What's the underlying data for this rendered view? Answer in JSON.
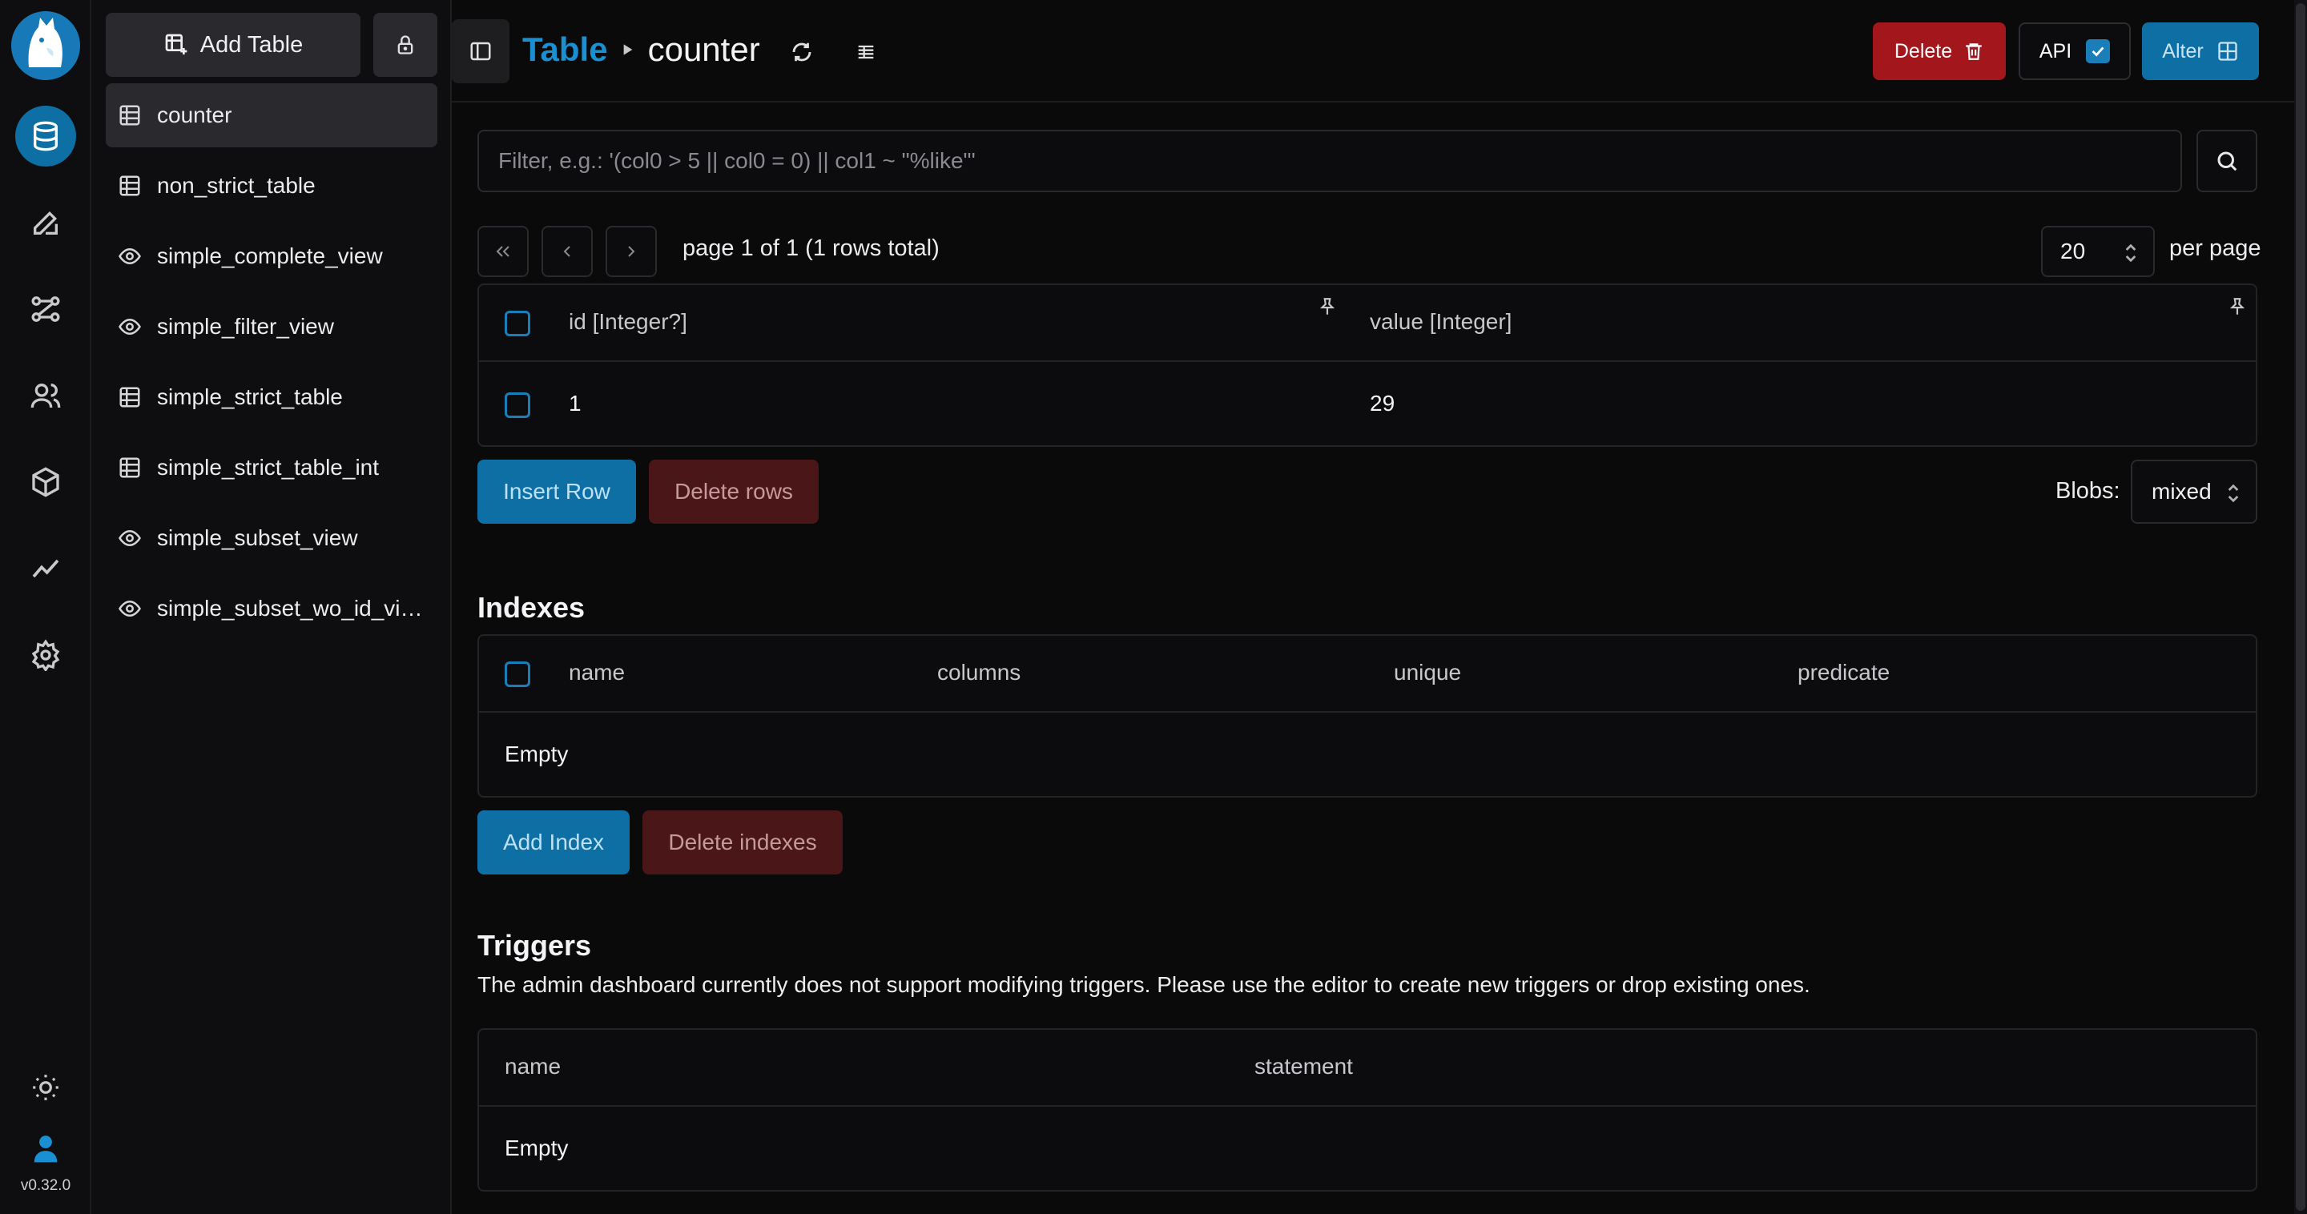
{
  "version": "v0.32.0",
  "sidebar": {
    "add_table_label": "Add Table",
    "items": [
      {
        "label": "counter",
        "kind": "table"
      },
      {
        "label": "non_strict_table",
        "kind": "table"
      },
      {
        "label": "simple_complete_view",
        "kind": "view"
      },
      {
        "label": "simple_filter_view",
        "kind": "view"
      },
      {
        "label": "simple_strict_table",
        "kind": "table"
      },
      {
        "label": "simple_strict_table_int",
        "kind": "table"
      },
      {
        "label": "simple_subset_view",
        "kind": "view"
      },
      {
        "label": "simple_subset_wo_id_vi…",
        "kind": "view"
      }
    ]
  },
  "header": {
    "section": "Table",
    "table_name": "counter",
    "delete_label": "Delete",
    "api_label": "API",
    "alter_label": "Alter"
  },
  "filter": {
    "placeholder": "Filter, e.g.: '(col0 > 5 || col0 = 0) || col1 ~ \"%like\"'"
  },
  "pagination": {
    "status": "page 1 of 1 (1 rows total)",
    "page_size": "20",
    "per_page_label": "per page"
  },
  "rows_table": {
    "columns": [
      "id [Integer?]",
      "value [Integer]"
    ],
    "rows": [
      [
        "1",
        "29"
      ]
    ]
  },
  "row_actions": {
    "insert_label": "Insert Row",
    "delete_label": "Delete rows",
    "blobs_label": "Blobs:",
    "blobs_value": "mixed"
  },
  "indexes": {
    "title": "Indexes",
    "columns": [
      "name",
      "columns",
      "unique",
      "predicate"
    ],
    "empty": "Empty",
    "add_label": "Add Index",
    "delete_label": "Delete indexes"
  },
  "triggers": {
    "title": "Triggers",
    "note": "The admin dashboard currently does not support modifying triggers. Please use the editor to create new triggers or drop existing ones.",
    "columns": [
      "name",
      "statement"
    ],
    "empty": "Empty"
  },
  "colors": {
    "accent": "#0d6fa3",
    "accent_text": "#1a8fd1",
    "danger": "#a3161c",
    "danger_muted": "#4a1618"
  }
}
